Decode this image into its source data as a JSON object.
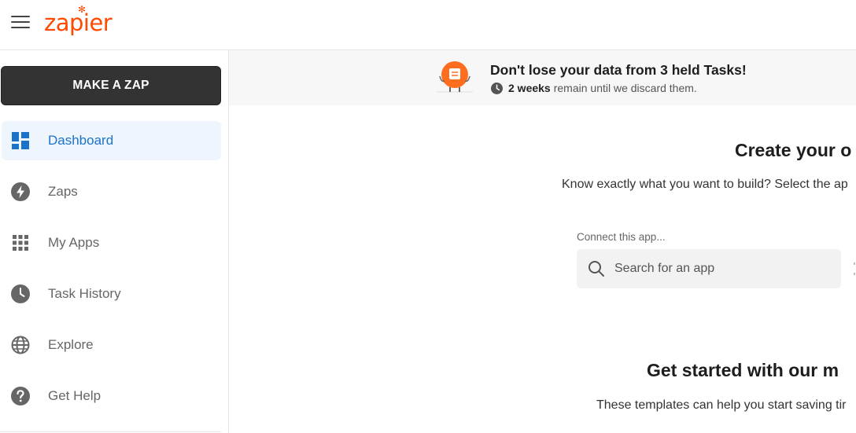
{
  "header": {
    "logo_text": "zapier",
    "brand_color": "#ff4a00"
  },
  "sidebar": {
    "make_zap_label": "MAKE A ZAP",
    "items": [
      {
        "label": "Dashboard",
        "icon": "dashboard-icon",
        "active": true
      },
      {
        "label": "Zaps",
        "icon": "bolt-icon",
        "active": false
      },
      {
        "label": "My Apps",
        "icon": "grid-icon",
        "active": false
      },
      {
        "label": "Task History",
        "icon": "clock-icon",
        "active": false
      },
      {
        "label": "Explore",
        "icon": "globe-icon",
        "active": false
      },
      {
        "label": "Get Help",
        "icon": "help-icon",
        "active": false
      }
    ],
    "active_color": "#1a73c9"
  },
  "banner": {
    "title": "Don't lose your data from 3 held Tasks!",
    "remaining_bold": "2 weeks",
    "remaining_rest": "remain until we discard them."
  },
  "main": {
    "title": "Create your o",
    "description": "Know exactly what you want to build? Select the ap",
    "connect_label": "Connect this app...",
    "search_placeholder": "Search for an app",
    "templates_title": "Get started with our m",
    "templates_desc": "These templates can help you start saving tir"
  }
}
